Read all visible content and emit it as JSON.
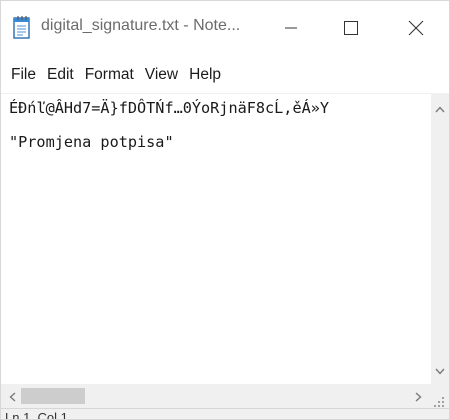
{
  "window": {
    "title": "digital_signature.txt - Note..."
  },
  "titlebar_buttons": {
    "minimize_icon": "minimize-icon",
    "maximize_icon": "maximize-icon",
    "close_icon": "close-icon"
  },
  "menu": {
    "items": [
      "File",
      "Edit",
      "Format",
      "View",
      "Help"
    ]
  },
  "editor": {
    "lines": [
      "ÉĐńľ@ÂHd7=Ä}fDÔTŃf…0ÝoRjnäF8cĹ,ěÁ»Y",
      "\"Promjena potpisa\""
    ]
  },
  "statusbar": {
    "text": "Ln 1, Col 1"
  },
  "colors": {
    "background": "#ffffff",
    "title_text": "#6b6b6b",
    "scrollbar_track": "#f0f0f0",
    "scrollbar_thumb": "#cdcdcd"
  }
}
